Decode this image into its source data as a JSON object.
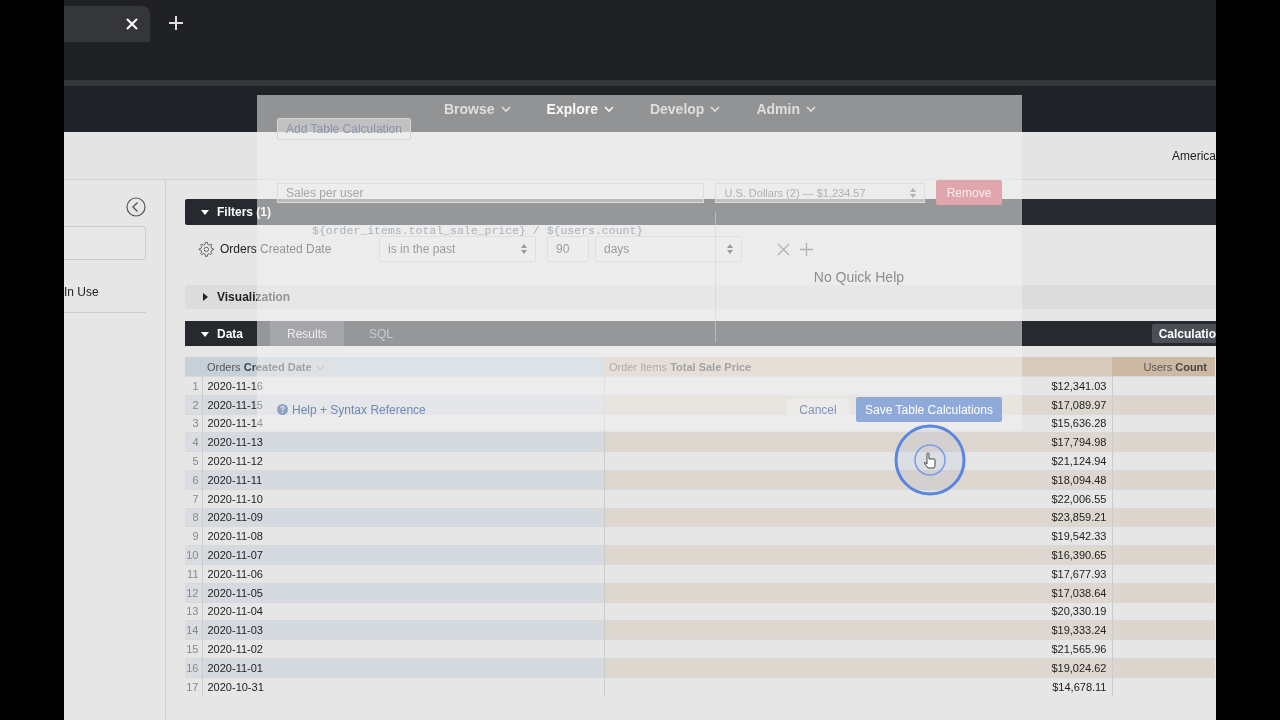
{
  "nav": {
    "items": [
      {
        "label": "Browse",
        "selected": false
      },
      {
        "label": "Explore",
        "selected": true
      },
      {
        "label": "Develop",
        "selected": false
      },
      {
        "label": "Admin",
        "selected": false
      }
    ]
  },
  "header": {
    "text": "America"
  },
  "sidebar": {
    "section_label": "In Use"
  },
  "filters": {
    "title": "Filters (1)",
    "expanded": true,
    "rows": [
      {
        "field": "Orders Created Date",
        "operator": "is in the past",
        "value": "90",
        "unit": "days"
      }
    ]
  },
  "visualization": {
    "title": "Visualization",
    "expanded": false
  },
  "data": {
    "title": "Data",
    "expanded": true,
    "tabs": [
      {
        "label": "Results",
        "selected": true
      },
      {
        "label": "SQL",
        "selected": false
      }
    ],
    "calculations_button": "Calculatio"
  },
  "table": {
    "columns": [
      {
        "label": "Orders **Created Date**",
        "color": "#c5d0d9",
        "sorted": true
      },
      {
        "label": "Order Items **Total Sale Price**",
        "color": "#d8cbbb",
        "sorted": false
      },
      {
        "label": "Users **Count**",
        "color": "#cdb8a3",
        "sorted": false
      }
    ],
    "rows": [
      {
        "index": "1",
        "date": "2020-11-16",
        "sale_price": "$12,341.03"
      },
      {
        "index": "2",
        "date": "2020-11-15",
        "sale_price": "$17,089.97"
      },
      {
        "index": "3",
        "date": "2020-11-14",
        "sale_price": "$15,636.28"
      },
      {
        "index": "4",
        "date": "2020-11-13",
        "sale_price": "$17,794.98"
      },
      {
        "index": "5",
        "date": "2020-11-12",
        "sale_price": "$21,124.94"
      },
      {
        "index": "6",
        "date": "2020-11-11",
        "sale_price": "$18,094.48"
      },
      {
        "index": "7",
        "date": "2020-11-10",
        "sale_price": "$22,006.55"
      },
      {
        "index": "8",
        "date": "2020-11-09",
        "sale_price": "$23,859.21"
      },
      {
        "index": "9",
        "date": "2020-11-08",
        "sale_price": "$19,542.33"
      },
      {
        "index": "10",
        "date": "2020-11-07",
        "sale_price": "$16,390.65"
      },
      {
        "index": "11",
        "date": "2020-11-06",
        "sale_price": "$17,677.93"
      },
      {
        "index": "12",
        "date": "2020-11-05",
        "sale_price": "$17,038.64"
      },
      {
        "index": "13",
        "date": "2020-11-04",
        "sale_price": "$20,330.19"
      },
      {
        "index": "14",
        "date": "2020-11-03",
        "sale_price": "$19,333.24"
      },
      {
        "index": "15",
        "date": "2020-11-02",
        "sale_price": "$21,565.96"
      },
      {
        "index": "16",
        "date": "2020-11-01",
        "sale_price": "$19,024.62"
      },
      {
        "index": "17",
        "date": "2020-10-31",
        "sale_price": "$14,678.11"
      }
    ]
  },
  "modal": {
    "add_button": "Add Table Calculation",
    "name": "Sales per user",
    "format": "U.S. Dollars (2) — $1,234.57",
    "remove_button": "Remove",
    "expression": "${order_items.total_sale_price} / ${users.count}",
    "quick_help": "No Quick Help",
    "help_link": "Help + Syntax Reference",
    "cancel_button": "Cancel",
    "save_button": "Save Table Calculations"
  }
}
